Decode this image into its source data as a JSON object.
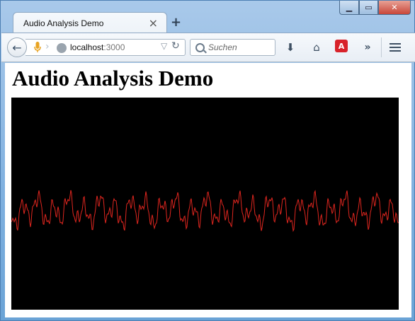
{
  "window": {
    "controls": {
      "minimize": "▁",
      "maximize": "▭",
      "close": "✕"
    }
  },
  "tabs": [
    {
      "title": "Audio Analysis Demo",
      "close_glyph": "×"
    }
  ],
  "newtab_glyph": "+",
  "toolbar": {
    "back_glyph": "←",
    "url": {
      "host": "localhost",
      "port": ":3000"
    },
    "url_dropdown_glyph": "▽",
    "reload_glyph": "↻",
    "search": {
      "placeholder": "Suchen"
    },
    "download_glyph": "⬇",
    "home_glyph": "⌂",
    "overflow_glyph": "»"
  },
  "page": {
    "heading": "Audio Analysis Demo"
  },
  "colors": {
    "waveform": "#e0261f",
    "canvas_bg": "#000000"
  },
  "icons": [
    "back-arrow-icon",
    "microphone-icon",
    "globe-icon",
    "search-icon",
    "download-icon",
    "home-icon",
    "avira-icon",
    "overflow-icon",
    "hamburger-menu-icon"
  ]
}
